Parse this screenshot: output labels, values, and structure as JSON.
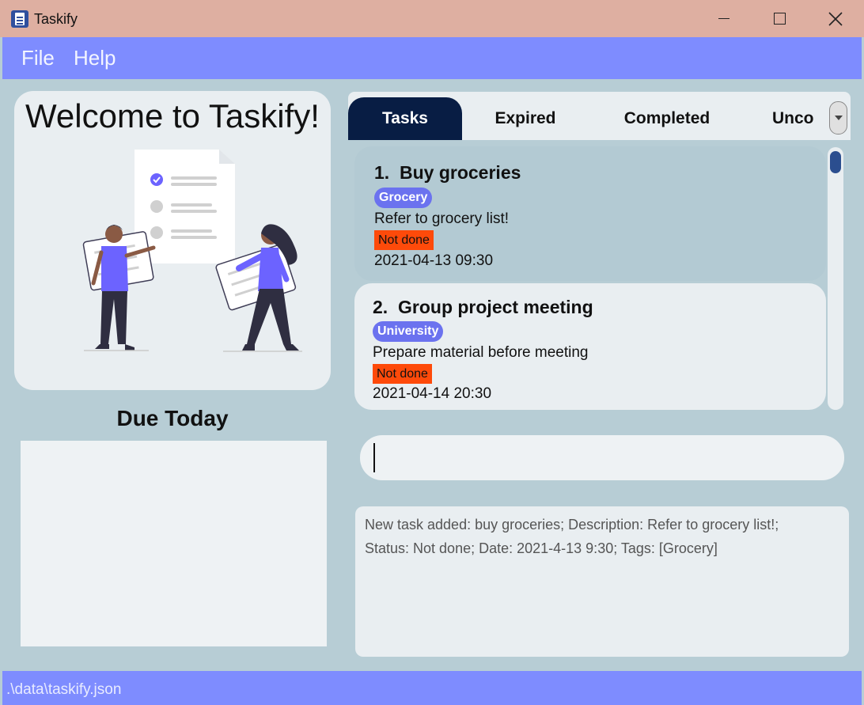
{
  "window": {
    "title": "Taskify",
    "icon": "clipboard-checklist-icon"
  },
  "menu": {
    "file": "File",
    "help": "Help"
  },
  "welcome": {
    "title": "Welcome to Taskify!",
    "illustration": "people-with-checklist-illustration"
  },
  "due_today": {
    "title": "Due Today",
    "items": []
  },
  "tabs": {
    "tasks": "Tasks",
    "expired": "Expired",
    "completed": "Completed",
    "uncompleted": "Unco",
    "active": "Tasks"
  },
  "tasks": [
    {
      "index": "1.",
      "name": "Buy groceries",
      "tag": "Grocery",
      "description": "Refer to grocery list!",
      "status": "Not done",
      "date": "2021-04-13 09:30"
    },
    {
      "index": "2.",
      "name": "Group project meeting",
      "tag": "University",
      "description": "Prepare material before meeting",
      "status": "Not done",
      "date": "2021-04-14 20:30"
    }
  ],
  "command": {
    "value": ""
  },
  "result": {
    "line1": "New task added: buy groceries; Description: Refer to grocery list!;",
    "line2": "Status: Not done; Date: 2021-4-13 9:30; Tags: [Grocery]"
  },
  "statusbar": {
    "path": ".\\data\\taskify.json"
  },
  "colors": {
    "menu_bar": "#7e8cff",
    "title_bar": "#deafa1",
    "active_tab": "#081d44",
    "tag": "#6b72ef",
    "status_not_done": "#fe4a0a",
    "background": "#b7cdd5"
  }
}
